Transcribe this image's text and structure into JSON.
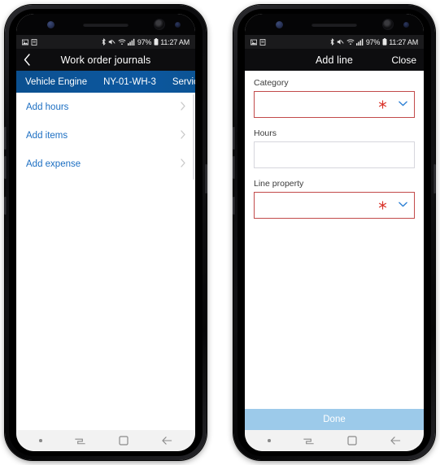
{
  "phones": [
    {
      "id": "left",
      "status_bar": {
        "left_icons": [
          "image-icon",
          "document-icon"
        ],
        "right_icons": [
          "bluetooth-icon",
          "mute-icon",
          "wifi-icon",
          "signal-icon"
        ],
        "battery_percent": "97%",
        "battery_icon": "battery-icon",
        "time": "11:27 AM"
      },
      "app_bar": {
        "back_icon": "chevron-left-icon",
        "title": "Work order journals"
      },
      "context_bar": {
        "items": [
          "Vehicle Engine",
          "NY-01-WH-3",
          "Service"
        ],
        "background": "#0b5394"
      },
      "list": [
        {
          "label": "Add hours",
          "chevron": "chevron-right-icon"
        },
        {
          "label": "Add items",
          "chevron": "chevron-right-icon"
        },
        {
          "label": "Add expense",
          "chevron": "chevron-right-icon"
        }
      ],
      "nav_bar": {
        "items": [
          "dot-icon",
          "recents-icon",
          "home-icon",
          "back-icon"
        ]
      }
    },
    {
      "id": "right",
      "status_bar": {
        "left_icons": [
          "image-icon",
          "document-icon"
        ],
        "right_icons": [
          "bluetooth-icon",
          "mute-icon",
          "wifi-icon",
          "signal-icon"
        ],
        "battery_percent": "97%",
        "battery_icon": "battery-icon",
        "time": "11:27 AM"
      },
      "app_bar": {
        "title": "Add line",
        "action_label": "Close"
      },
      "fields": [
        {
          "label": "Category",
          "value": "",
          "required": true,
          "required_marker": "*",
          "dropdown_icon": "chevron-down-icon",
          "border_color": "#c24a4a"
        },
        {
          "label": "Hours",
          "value": "",
          "required": false,
          "border_color": "#d6d6dd"
        },
        {
          "label": "Line property",
          "value": "",
          "required": true,
          "required_marker": "*",
          "dropdown_icon": "chevron-down-icon",
          "border_color": "#c24a4a"
        }
      ],
      "primary_button": {
        "label": "Done",
        "enabled": false,
        "background": "#9ccaea"
      },
      "nav_bar": {
        "items": [
          "dot-icon",
          "recents-icon",
          "home-icon",
          "back-icon"
        ]
      }
    }
  ],
  "colors": {
    "accent_blue": "#0b5394",
    "link_blue": "#1b6ec2",
    "required_red": "#c24a4a",
    "asterisk_red": "#d9342b",
    "dropdown_blue": "#2b7fd4",
    "done_blue": "#9ccaea",
    "page_background": "#ffffff"
  }
}
